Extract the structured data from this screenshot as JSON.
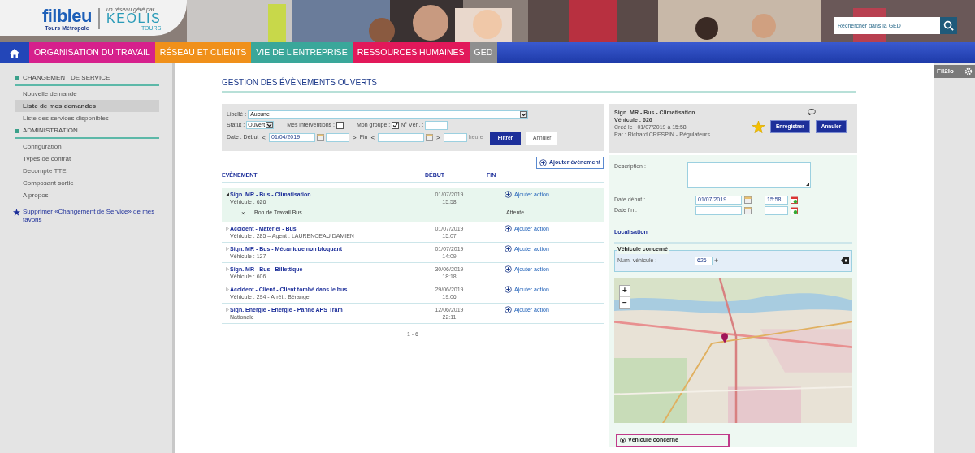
{
  "header": {
    "logo": {
      "brand": "filbleu",
      "subtitle": "Tours Métropole",
      "tagline": "un réseau géré par",
      "operator": "KEOLIS",
      "operator_city": "TOURS"
    },
    "search": {
      "placeholder": "Rechercher dans la GED"
    }
  },
  "nav": [
    {
      "label": "ORGANISATION DU TRAVAIL",
      "color": "#d6208c"
    },
    {
      "label": "RÉSEAU ET CLIENTS",
      "color": "#f0901a"
    },
    {
      "label": "VIE DE L'ENTREPRISE",
      "color": "#3aa79a"
    },
    {
      "label": "RESSOURCES HUMAINES",
      "color": "#e2185a"
    },
    {
      "label": "GED",
      "color": "#8f8f8f"
    }
  ],
  "sidebar": {
    "sections": [
      {
        "title": "CHANGEMENT DE SERVICE",
        "items": [
          {
            "label": "Nouvelle demande",
            "selected": false
          },
          {
            "label": "Liste de mes demandes",
            "selected": true
          },
          {
            "label": "Liste des services disponibles",
            "selected": false
          }
        ]
      },
      {
        "title": "ADMINISTRATION",
        "items": [
          {
            "label": "Configuration",
            "selected": false
          },
          {
            "label": "Types de contrat",
            "selected": false
          },
          {
            "label": "Decompte TTE",
            "selected": false
          },
          {
            "label": "Composant sortie",
            "selected": false
          },
          {
            "label": "A propos",
            "selected": false
          }
        ]
      }
    ],
    "favorite_link": "Supprimer «Changement de Service» de mes favoris"
  },
  "page_title": "GESTION DES ÉVÈNEMENTS OUVERTS",
  "filter": {
    "libelle_label": "Libellé :",
    "libelle_value": "Aucune",
    "statut_label": "Statut :",
    "statut_value": "Ouvert",
    "mes_interventions_label": "Mes interventions :",
    "mes_interventions_checked": false,
    "mon_groupe_label": "Mon groupe :",
    "mon_groupe_checked": true,
    "vehicule_label": "N° Véh. :",
    "date_label": "Date : Début",
    "debut_prev": "<",
    "debut_value": "01/04/2019",
    "debut_next": ">",
    "fin_label": "Fin",
    "fin_prev": "<",
    "fin_next": ">",
    "heure_label": "heure",
    "filter_button": "Filtrer",
    "cancel_button": "Annuler"
  },
  "add_event_button": "Ajouter évènement",
  "table": {
    "columns": [
      "EVÈNEMENT",
      "DÉBUT",
      "FIN"
    ],
    "rows": [
      {
        "title": "Sign. MR - Bus - Climatisation",
        "detail": "Véhicule : 626",
        "date": "01/07/2019",
        "time": "15:58",
        "action": "Ajouter action",
        "expanded": true,
        "selected": true,
        "children": [
          {
            "label": "Bon de Travail Bus",
            "remove": "×",
            "status": "Attente"
          }
        ]
      },
      {
        "title": "Accident - Matériel - Bus",
        "detail": "Véhicule : 285 – Agent : LAURENCEAU DAMIEN",
        "date": "01/07/2019",
        "time": "15:07",
        "action": "Ajouter action",
        "expanded": false,
        "selected": false
      },
      {
        "title": "Sign. MR - Bus - Mécanique non bloquant",
        "detail": "Véhicule : 127",
        "date": "01/07/2019",
        "time": "14:09",
        "action": "Ajouter action",
        "expanded": false,
        "selected": false
      },
      {
        "title": "Sign. MR - Bus - Billettique",
        "detail": "Véhicule : 606",
        "date": "30/06/2019",
        "time": "18:18",
        "action": "Ajouter action",
        "expanded": false,
        "selected": false
      },
      {
        "title": "Accident - Client - Client tombé dans le bus",
        "detail": "Véhicule : 294 - Arrêt : Béranger",
        "date": "29/06/2019",
        "time": "19:06",
        "action": "Ajouter action",
        "expanded": false,
        "selected": false
      },
      {
        "title": "Sign. Energie - Energie - Panne APS Tram",
        "detail": "Nationale",
        "date": "12/06/2019",
        "time": "22:11",
        "action": "Ajouter action",
        "expanded": false,
        "selected": false
      }
    ],
    "pagination": "1 - 6"
  },
  "detail": {
    "title": "Sign. MR - Bus - Climatisation",
    "vehicle": "Véhicule : 626",
    "created": "Créé le : 01/07/2019 à 15:58",
    "author": "Par : Richard CRESPIN - Régulateurs",
    "favorite": true,
    "save_button": "Enregistrer",
    "cancel_button": "Annuler",
    "description_label": "Description :",
    "date_debut_label": "Date début :",
    "date_debut_value": "01/07/2019",
    "heure_debut_value": "15:58",
    "date_fin_label": "Date fin :",
    "localisation_title": "Localisation",
    "vehicle_section_title": "Véhicule concerné",
    "num_vehicule_label": "Num. véhicule :",
    "num_vehicule_value": "626",
    "add_sign": "+",
    "map": {
      "zoom_in": "+",
      "zoom_out": "−"
    },
    "radio": {
      "label": "Véhicule concerné",
      "selected": true
    }
  },
  "right_panel": {
    "title": "Fil2lo"
  }
}
